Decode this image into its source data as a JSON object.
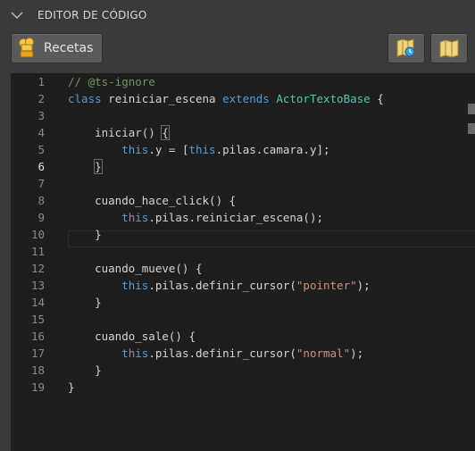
{
  "panel": {
    "title": "EDITOR DE CÓDIGO"
  },
  "toolbar": {
    "recetas_label": "Recetas",
    "recetas_icon": "chef-hat-icon",
    "map_icon": "map-icon",
    "map_edit_icon": "map-timer-icon"
  },
  "editor": {
    "active_line": 6,
    "line_numbers": [
      "1",
      "2",
      "3",
      "4",
      "5",
      "6",
      "7",
      "8",
      "9",
      "10",
      "11",
      "12",
      "13",
      "14",
      "15",
      "16",
      "17",
      "18",
      "19"
    ],
    "lines": {
      "l1": "// @ts-ignore",
      "l2_kw1": "class",
      "l2_name": " reiniciar_escena ",
      "l2_kw2": "extends",
      "l2_sp": " ",
      "l2_base": "ActorTextoBase",
      "l2_end": " {",
      "l4_a": "    iniciar() ",
      "l4_b": "{",
      "l5_indent": "        ",
      "l5_this1": "this",
      "l5_mid": ".y = [",
      "l5_this2": "this",
      "l5_end": ".pilas.camara.y];",
      "l6_indent": "    ",
      "l6_b": "}",
      "l8": "    cuando_hace_click() {",
      "l9_indent": "        ",
      "l9_this": "this",
      "l9_end": ".pilas.reiniciar_escena();",
      "l10": "    }",
      "l12": "    cuando_mueve() {",
      "l13_indent": "        ",
      "l13_this": "this",
      "l13_mid": ".pilas.definir_cursor(",
      "l13_str": "\"pointer\"",
      "l13_end": ");",
      "l14": "    }",
      "l16": "    cuando_sale() {",
      "l17_indent": "        ",
      "l17_this": "this",
      "l17_mid": ".pilas.definir_cursor(",
      "l17_str": "\"normal\"",
      "l17_end": ");",
      "l18": "    }",
      "l19": "}"
    }
  },
  "colors": {
    "keyword": "#569cd6",
    "class_name": "#4ec9b0",
    "comment": "#6a9955",
    "string": "#ce9178",
    "text": "#d4d4d4",
    "background": "#1e1e1e",
    "panel": "#3a3a3a"
  }
}
